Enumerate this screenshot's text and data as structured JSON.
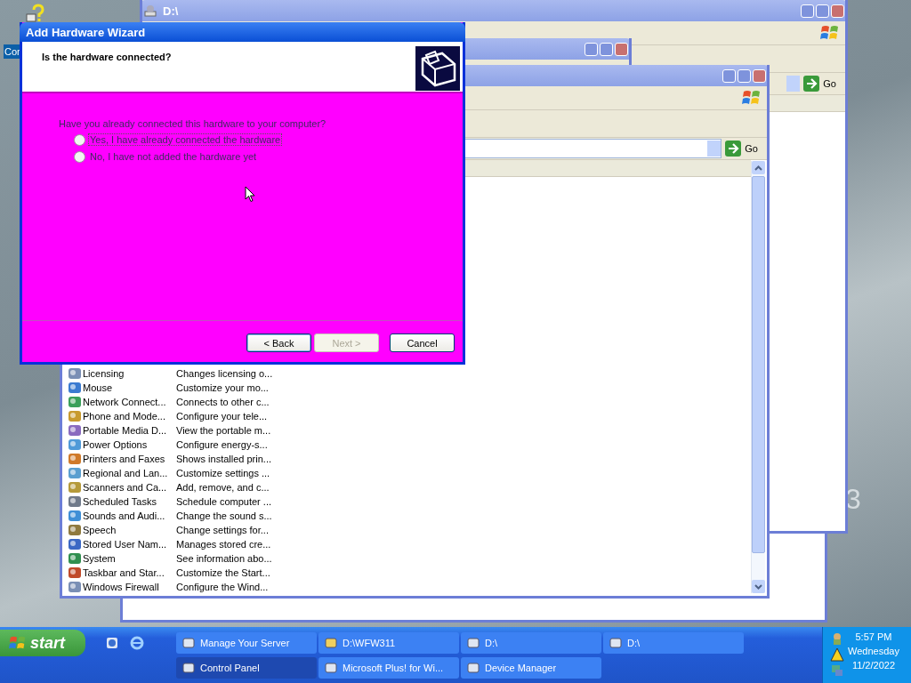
{
  "desktop": {
    "icon_label": "Cor",
    "wallpaper_text": "3"
  },
  "back_window": {
    "title": "D:\\",
    "go_label": "Go"
  },
  "control_panel": {
    "go_label": "Go",
    "rows": [
      {
        "name": "Licensing",
        "description": "Changes licensing o..."
      },
      {
        "name": "Mouse",
        "description": "Customize your mo..."
      },
      {
        "name": "Network Connect...",
        "description": "Connects to other c..."
      },
      {
        "name": "Phone and Mode...",
        "description": "Configure your tele..."
      },
      {
        "name": "Portable Media D...",
        "description": "View the portable m..."
      },
      {
        "name": "Power Options",
        "description": "Configure energy-s..."
      },
      {
        "name": "Printers and Faxes",
        "description": "Shows installed prin..."
      },
      {
        "name": "Regional and Lan...",
        "description": "Customize settings ..."
      },
      {
        "name": "Scanners and Ca...",
        "description": "Add, remove, and c..."
      },
      {
        "name": "Scheduled Tasks",
        "description": "Schedule computer ..."
      },
      {
        "name": "Sounds and Audi...",
        "description": "Change the sound s..."
      },
      {
        "name": "Speech",
        "description": "Change settings for..."
      },
      {
        "name": "Stored User Nam...",
        "description": "Manages stored cre..."
      },
      {
        "name": "System",
        "description": "See information abo..."
      },
      {
        "name": "Taskbar and Star...",
        "description": "Customize the Start..."
      },
      {
        "name": "Windows Firewall",
        "description": "Configure the Wind..."
      }
    ]
  },
  "dialog": {
    "title": "Add Hardware Wizard",
    "heading": "Is the hardware connected?",
    "question": "Have you already connected this hardware to your computer?",
    "options": [
      {
        "label": "Yes, I have already connected the hardware",
        "selected": false,
        "focused": true
      },
      {
        "label": "No, I have not added the hardware yet",
        "selected": false,
        "focused": false
      }
    ],
    "buttons": [
      {
        "label": "< Back",
        "disabled": false,
        "default": true
      },
      {
        "label": "Next >",
        "disabled": true,
        "default": false
      },
      {
        "label": "Cancel",
        "disabled": false,
        "default": false
      }
    ]
  },
  "taskbar": {
    "start_label": "start",
    "tasks": [
      {
        "label": "Manage Your Server",
        "selected": false
      },
      {
        "label": "D:\\WFW311",
        "selected": false
      },
      {
        "label": "D:\\",
        "selected": false
      },
      {
        "label": "D:\\",
        "selected": false
      },
      {
        "label": "Control Panel",
        "selected": true
      },
      {
        "label": "Microsoft Plus! for Wi...",
        "selected": false
      },
      {
        "label": "Device Manager",
        "selected": false
      }
    ],
    "clock": {
      "time": "5:57 PM",
      "day": "Wednesday",
      "date": "11/2/2022"
    }
  }
}
